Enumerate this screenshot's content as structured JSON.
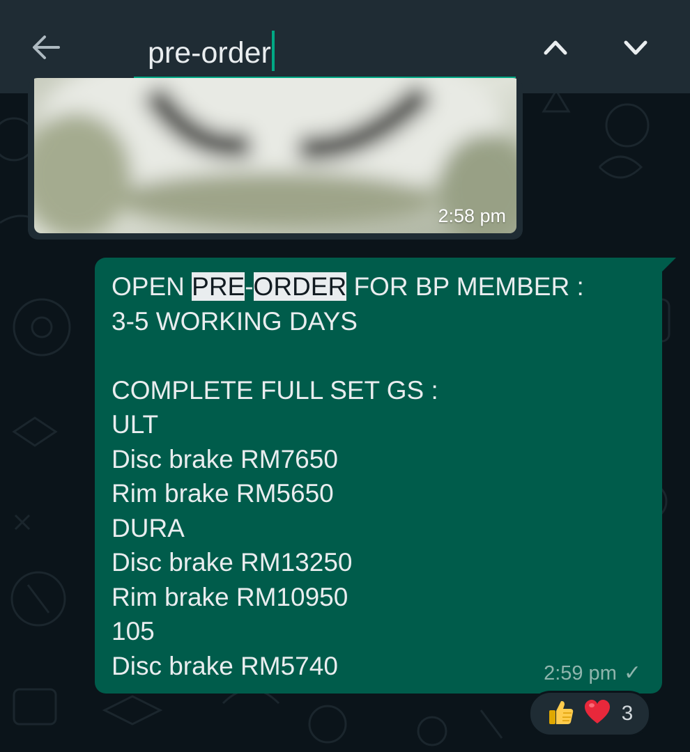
{
  "search": {
    "query": "pre-order",
    "back_icon": "arrow-left-icon",
    "prev_icon": "chevron-up-icon",
    "next_icon": "chevron-down-icon",
    "accent_color": "#00a884"
  },
  "image_message": {
    "time": "2:58 pm"
  },
  "text_message": {
    "line1": {
      "pre": "OPEN ",
      "hl1": "PRE",
      "mid": "-",
      "hl2": "ORDER",
      "post": " FOR BP MEMBER :"
    },
    "lines": [
      "3-5 WORKING DAYS",
      "",
      "COMPLETE FULL SET GS :",
      "ULT",
      "Disc brake RM7650",
      "Rim brake RM5650",
      "DURA",
      "Disc brake RM13250",
      "Rim brake RM10950",
      "105",
      "Disc brake RM5740"
    ],
    "time": "2:59 pm",
    "status_icon": "single-check-icon",
    "bubble_color": "#005c4b"
  },
  "reactions": {
    "emojis": [
      "👍",
      "❤️"
    ],
    "count": "3"
  }
}
